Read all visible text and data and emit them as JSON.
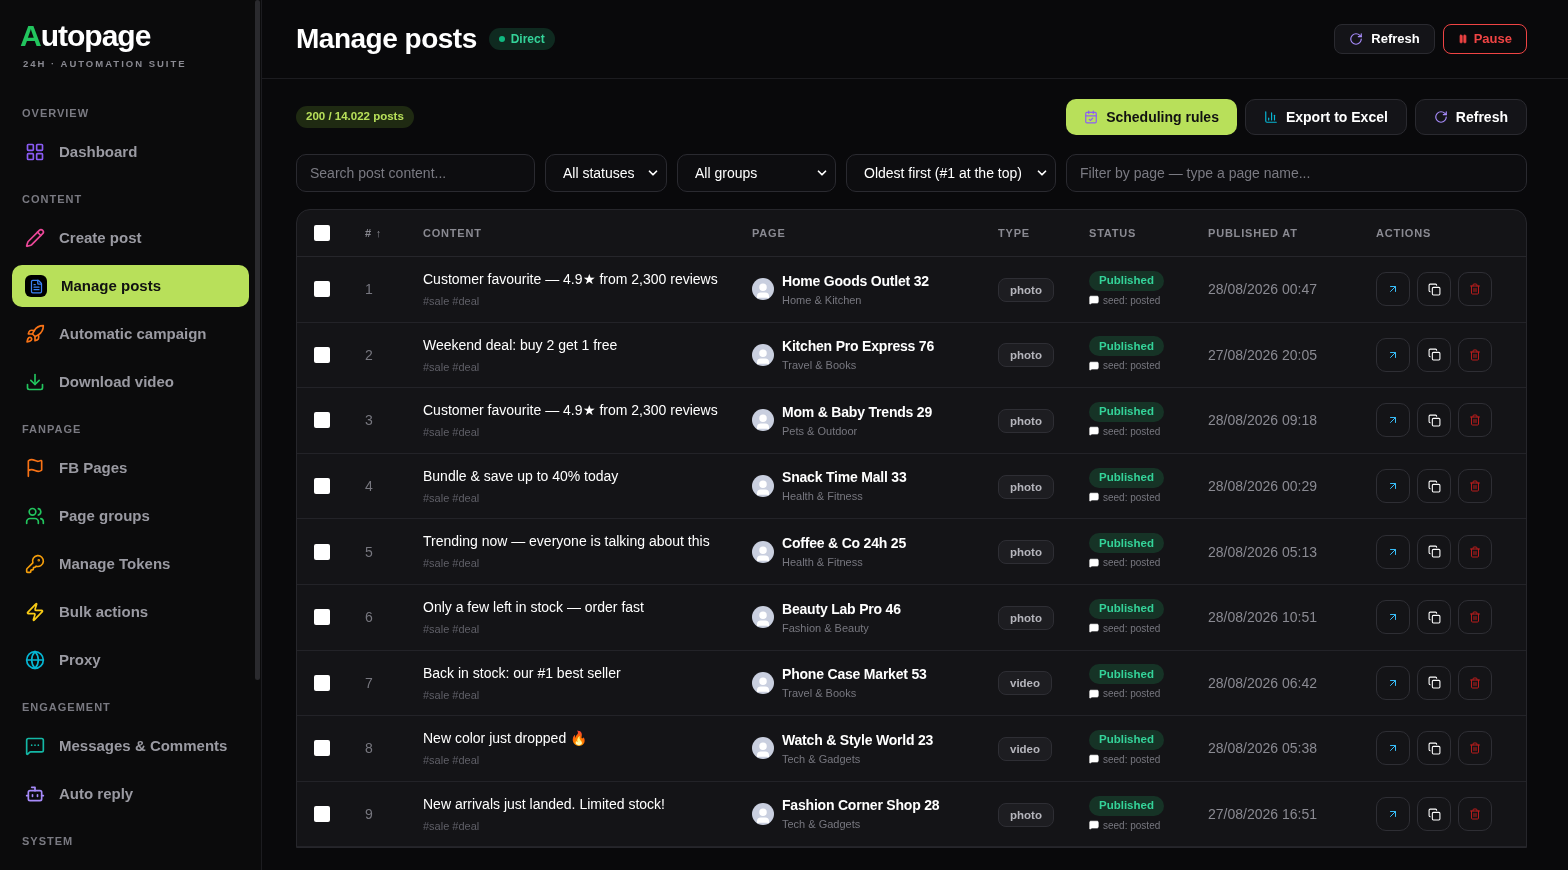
{
  "brand": {
    "logo": "Autopage",
    "tagline": "24H · AUTOMATION SUITE"
  },
  "sidebar": {
    "sections": [
      {
        "title": "OVERVIEW",
        "items": [
          {
            "label": "Dashboard",
            "selected": false
          }
        ]
      },
      {
        "title": "CONTENT",
        "items": [
          {
            "label": "Create post",
            "selected": false
          },
          {
            "label": "Manage posts",
            "selected": true
          },
          {
            "label": "Automatic campaign",
            "selected": false
          },
          {
            "label": "Download video",
            "selected": false
          }
        ]
      },
      {
        "title": "FANPAGE",
        "items": [
          {
            "label": "FB Pages",
            "selected": false
          },
          {
            "label": "Page groups",
            "selected": false
          },
          {
            "label": "Manage Tokens",
            "selected": false
          },
          {
            "label": "Bulk actions",
            "selected": false
          },
          {
            "label": "Proxy",
            "selected": false
          }
        ]
      },
      {
        "title": "ENGAGEMENT",
        "items": [
          {
            "label": "Messages & Comments",
            "selected": false
          },
          {
            "label": "Auto reply",
            "selected": false
          }
        ]
      },
      {
        "title": "SYSTEM"
      }
    ]
  },
  "header": {
    "title": "Manage posts",
    "mode_badge": "Direct",
    "buttons": [
      {
        "label": "Refresh",
        "kind": "refresh"
      },
      {
        "label": "Pause",
        "kind": "pause"
      }
    ]
  },
  "toolbar": {
    "count_badge": "200 / 14.022 posts",
    "buttons": [
      {
        "label": "Scheduling rules",
        "kind": "primary"
      },
      {
        "label": "Export to Excel",
        "kind": "export"
      },
      {
        "label": "Refresh",
        "kind": "refresh"
      }
    ]
  },
  "filters": {
    "search": {
      "placeholder": "Search post content..."
    },
    "selects": [
      "All statuses",
      "All groups",
      "Oldest first (#1 at the top)"
    ],
    "page_filter": {
      "placeholder": "Filter by page — type a page name..."
    }
  },
  "table": {
    "select_all": {
      "checked": false
    },
    "columns": [
      "# ↑",
      "CONTENT",
      "PAGE",
      "TYPE",
      "STATUS",
      "PUBLISHED AT",
      "ACTIONS"
    ],
    "rows": [
      {
        "checked": false,
        "index": "1",
        "content": "Customer favourite — 4.9★ from 2,300 reviews",
        "tags": "#sale #deal",
        "page": "Home Goods Outlet 32",
        "category": "Home & Kitchen",
        "type": "photo",
        "status": "Published",
        "seed": "seed: posted",
        "published_at": "28/08/2026 00:47"
      },
      {
        "checked": false,
        "index": "2",
        "content": "Weekend deal: buy 2 get 1 free",
        "tags": "#sale #deal",
        "page": "Kitchen Pro Express 76",
        "category": "Travel & Books",
        "type": "photo",
        "status": "Published",
        "seed": "seed: posted",
        "published_at": "27/08/2026 20:05"
      },
      {
        "checked": false,
        "index": "3",
        "content": "Customer favourite — 4.9★ from 2,300 reviews",
        "tags": "#sale #deal",
        "page": "Mom & Baby Trends 29",
        "category": "Pets & Outdoor",
        "type": "photo",
        "status": "Published",
        "seed": "seed: posted",
        "published_at": "28/08/2026 09:18"
      },
      {
        "checked": false,
        "index": "4",
        "content": "Bundle & save up to 40% today",
        "tags": "#sale #deal",
        "page": "Snack Time Mall 33",
        "category": "Health & Fitness",
        "type": "photo",
        "status": "Published",
        "seed": "seed: posted",
        "published_at": "28/08/2026 00:29"
      },
      {
        "checked": false,
        "index": "5",
        "content": "Trending now — everyone is talking about this",
        "tags": "#sale #deal",
        "page": "Coffee & Co 24h 25",
        "category": "Health & Fitness",
        "type": "photo",
        "status": "Published",
        "seed": "seed: posted",
        "published_at": "28/08/2026 05:13"
      },
      {
        "checked": false,
        "index": "6",
        "content": "Only a few left in stock — order fast",
        "tags": "#sale #deal",
        "page": "Beauty Lab Pro 46",
        "category": "Fashion & Beauty",
        "type": "photo",
        "status": "Published",
        "seed": "seed: posted",
        "published_at": "28/08/2026 10:51"
      },
      {
        "checked": false,
        "index": "7",
        "content": "Back in stock: our #1 best seller",
        "tags": "#sale #deal",
        "page": "Phone Case Market 53",
        "category": "Travel & Books",
        "type": "video",
        "status": "Published",
        "seed": "seed: posted",
        "published_at": "28/08/2026 06:42"
      },
      {
        "checked": false,
        "index": "8",
        "content": "New color just dropped 🔥",
        "tags": "#sale #deal",
        "page": "Watch & Style World 23",
        "category": "Tech & Gadgets",
        "type": "video",
        "status": "Published",
        "seed": "seed: posted",
        "published_at": "28/08/2026 05:38"
      },
      {
        "checked": false,
        "index": "9",
        "content": "New arrivals just landed. Limited stock!",
        "tags": "#sale #deal",
        "page": "Fashion Corner Shop 28",
        "category": "Tech & Gadgets",
        "type": "photo",
        "status": "Published",
        "seed": "seed: posted",
        "published_at": "27/08/2026 16:51"
      }
    ]
  }
}
